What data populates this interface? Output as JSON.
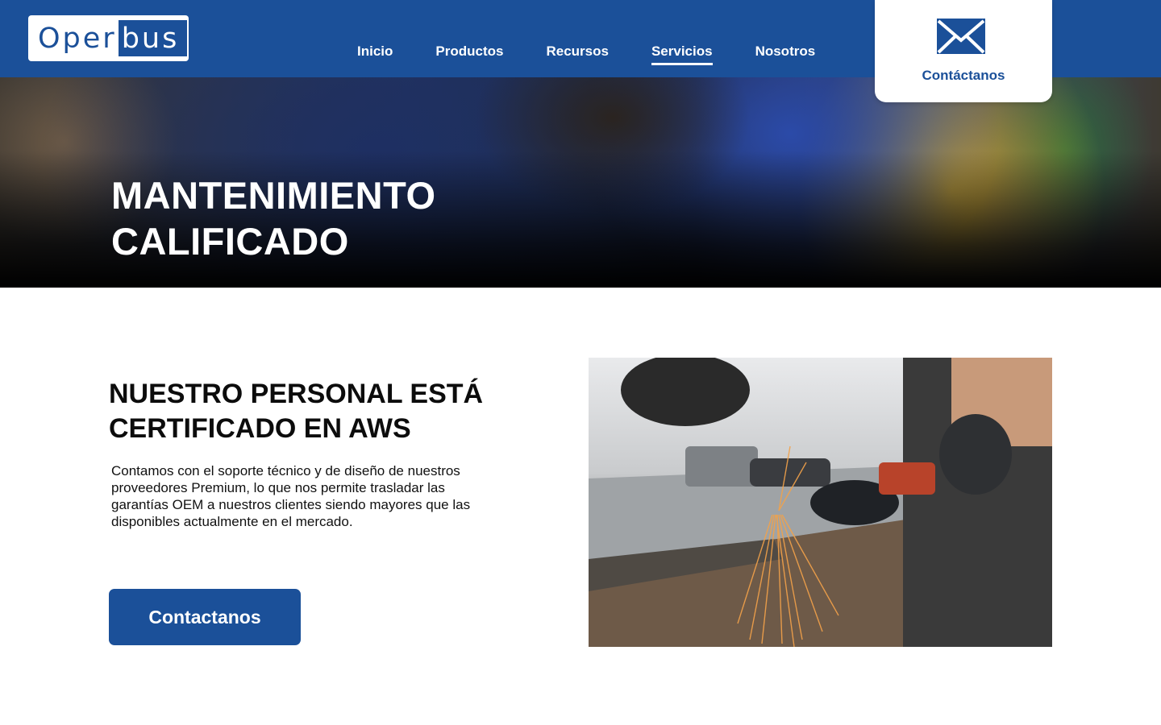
{
  "brand": {
    "logo_part1": "Oper",
    "logo_part2": "bus",
    "primary_color": "#1b5099"
  },
  "nav": {
    "items": [
      {
        "label": "Inicio"
      },
      {
        "label": "Productos"
      },
      {
        "label": "Recursos"
      },
      {
        "label": "Servicios",
        "active": true
      },
      {
        "label": "Nosotros"
      }
    ]
  },
  "contact_card": {
    "icon": "envelope-icon",
    "label": "Contáctanos"
  },
  "hero": {
    "title_line1": "MANTENIMIENTO",
    "title_line2": "CALIFICADO"
  },
  "section": {
    "title_line1": "NUESTRO PERSONAL ESTÁ",
    "title_line2": "CERTIFICADO EN AWS",
    "body": "Contamos con el soporte técnico y de diseño de nuestros proveedores Premium, lo que nos permite trasladar las garantías OEM a nuestros clientes siendo mayores que las disponibles actualmente en el mercado.",
    "button_label": "Contactanos"
  }
}
